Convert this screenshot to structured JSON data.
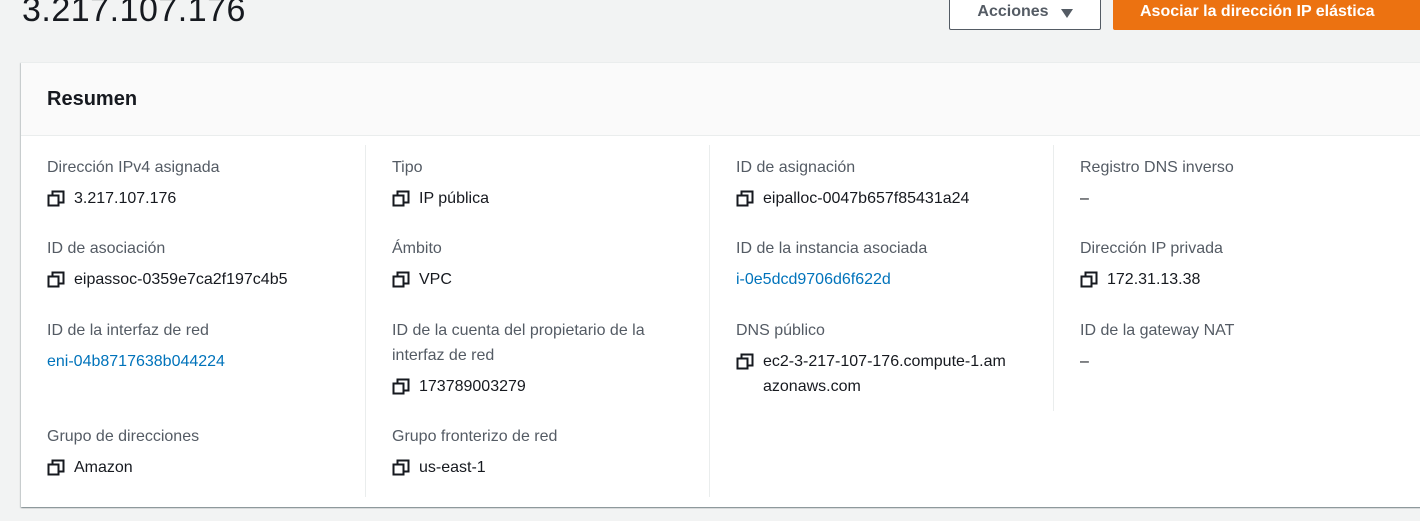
{
  "header": {
    "title": "3.217.107.176",
    "actions_label": "Acciones",
    "primary_label": "Asociar la dirección IP elástica"
  },
  "summary": {
    "title": "Resumen",
    "columns": [
      [
        {
          "label": "Dirección IPv4 asignada",
          "value": "3.217.107.176"
        },
        {
          "label": "ID de asociación",
          "value": "eipassoc-0359e7ca2f197c4b5"
        },
        {
          "label": "ID de la interfaz de red",
          "value": "eni-04b8717638b044224"
        },
        {
          "label": "Grupo de direcciones",
          "value": "Amazon"
        }
      ],
      [
        {
          "label": "Tipo",
          "value": "IP pública"
        },
        {
          "label": "Ámbito",
          "value": "VPC"
        },
        {
          "label": "ID de la cuenta del propietario de la interfaz de red",
          "value": "173789003279"
        },
        {
          "label": "Grupo fronterizo de red",
          "value": "us-east-1"
        }
      ],
      [
        {
          "label": "ID de asignación",
          "value": "eipalloc-0047b657f85431a24"
        },
        {
          "label": "ID de la instancia asociada",
          "value": "i-0e5dcd9706d6f622d"
        },
        {
          "label": "DNS público",
          "value": "ec2-3-217-107-176.compute-1.amazonaws.com"
        }
      ],
      [
        {
          "label": "Registro DNS inverso",
          "value": "–"
        },
        {
          "label": "Dirección IP privada",
          "value": "172.31.13.38"
        },
        {
          "label": "ID de la gateway NAT",
          "value": "–"
        }
      ]
    ]
  },
  "icons": {
    "copy": "copy-icon",
    "dropdown": "caret-down-icon"
  },
  "colors": {
    "accent": "#ec7211",
    "link": "#0073bb"
  }
}
